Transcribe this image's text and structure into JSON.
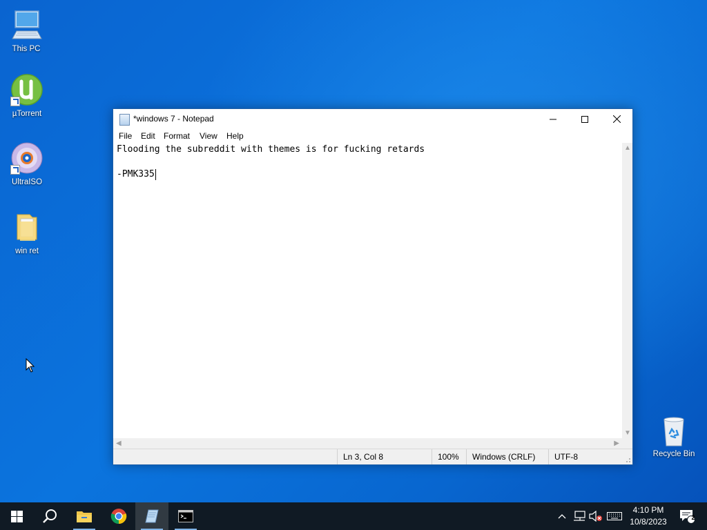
{
  "desktop": {
    "icons": [
      {
        "label": "This PC",
        "icon": "computer-icon"
      },
      {
        "label": "µTorrent",
        "icon": "utorrent-icon"
      },
      {
        "label": "UltraISO",
        "icon": "disc-icon"
      },
      {
        "label": "win ret",
        "icon": "folder-icon"
      }
    ],
    "recycle_bin": {
      "label": "Recycle Bin",
      "icon": "recycle-bin-icon"
    }
  },
  "notepad": {
    "title": "*windows 7 - Notepad",
    "menu": [
      "File",
      "Edit",
      "Format",
      "View",
      "Help"
    ],
    "content": {
      "line1": "Flooding the subreddit with themes is for fucking retards",
      "line2": "",
      "line3": "-PMK335"
    },
    "status": {
      "position": "Ln 3, Col 8",
      "zoom": "100%",
      "line_ending": "Windows (CRLF)",
      "encoding": "UTF-8"
    }
  },
  "taskbar": {
    "apps": [
      "start-icon",
      "search-icon",
      "file-explorer-icon",
      "chrome-icon",
      "notepad-icon",
      "command-prompt-icon"
    ],
    "tray": {
      "time": "4:10 PM",
      "date": "10/8/2023",
      "notification_count": "2"
    }
  },
  "colors": {
    "accent": "#0a74da",
    "taskbar": "#101a24"
  }
}
